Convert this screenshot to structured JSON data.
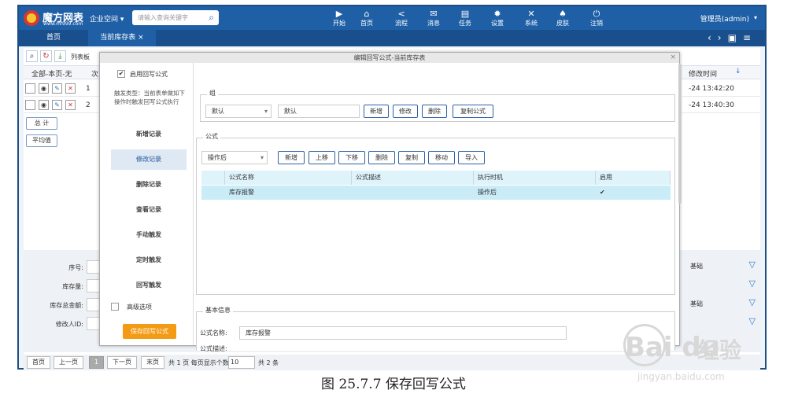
{
  "app": {
    "logo_name": "魔方网表",
    "logo_url": "www.mf999.com",
    "enterprise_label": "企业空间",
    "search_placeholder": "请输入查询关键字",
    "user_label": "管理员(admin)",
    "nav": [
      {
        "label": "开始",
        "icon": "play-icon"
      },
      {
        "label": "首页",
        "icon": "home-icon"
      },
      {
        "label": "流程",
        "icon": "share-icon"
      },
      {
        "label": "消息",
        "icon": "mail-icon"
      },
      {
        "label": "任务",
        "icon": "task-icon"
      },
      {
        "label": "设置",
        "icon": "gear-icon"
      },
      {
        "label": "系统",
        "icon": "wrench-icon"
      },
      {
        "label": "皮肤",
        "icon": "shirt-icon"
      },
      {
        "label": "注销",
        "icon": "power-icon"
      }
    ]
  },
  "tabs": [
    {
      "label": "首页"
    },
    {
      "label": "当前库存表"
    }
  ],
  "background": {
    "toolbar_label": "列表板",
    "col_all": "全部-本页-无",
    "col_seq": "次",
    "col_modified": "修改时间",
    "rows": [
      {
        "num": "1",
        "time": "-24 13:42:20"
      },
      {
        "num": "2",
        "time": "-24 13:40:30"
      }
    ],
    "total_btn": "总 计",
    "avg_btn": "平均值",
    "form_fields": [
      "序号:",
      "库存量:",
      "库存总金额:",
      "修改人ID:"
    ],
    "right_labels": [
      "基础",
      "基础"
    ]
  },
  "pager": {
    "first": "首页",
    "prev": "上一页",
    "current": "1",
    "next": "下一页",
    "last": "末页",
    "info": "共 1 页 每页显示个数:",
    "page_size": "10",
    "total": "共 2 条"
  },
  "modal": {
    "title": "编辑回写公式-当前库存表",
    "enable_label": "启用回写公式",
    "trigger_desc": "触发类型：当前表单做如下操作时触发回写公式执行",
    "left_items": [
      "新增记录",
      "修改记录",
      "删除记录",
      "查看记录",
      "手动触发",
      "定时触发",
      "回写触发"
    ],
    "advanced_label": "高级选项",
    "save_btn": "保存回写公式",
    "group_title": "组",
    "group_select": "默认",
    "group_input": "默认",
    "group_buttons": [
      "新增",
      "修改",
      "删除",
      "复制公式"
    ],
    "formula_title": "公式",
    "timing_select": "操作后",
    "formula_buttons": [
      "新增",
      "上移",
      "下移",
      "删除",
      "复制",
      "移动",
      "导入"
    ],
    "table_headers": [
      "公式名称",
      "公式描述",
      "执行时机",
      "启用"
    ],
    "table_rows": [
      {
        "name": "库存报警",
        "desc": "",
        "timing": "操作后",
        "enabled": "✔"
      }
    ],
    "basic_title": "基本信息",
    "formula_name_label": "公式名称:",
    "formula_name_value": "库存报警",
    "formula_desc_label": "公式描述:"
  },
  "caption": "图 25.7.7  保存回写公式",
  "watermark": {
    "logo": "Bai du",
    "text": "经验",
    "url": "jingyan.baidu.com"
  }
}
